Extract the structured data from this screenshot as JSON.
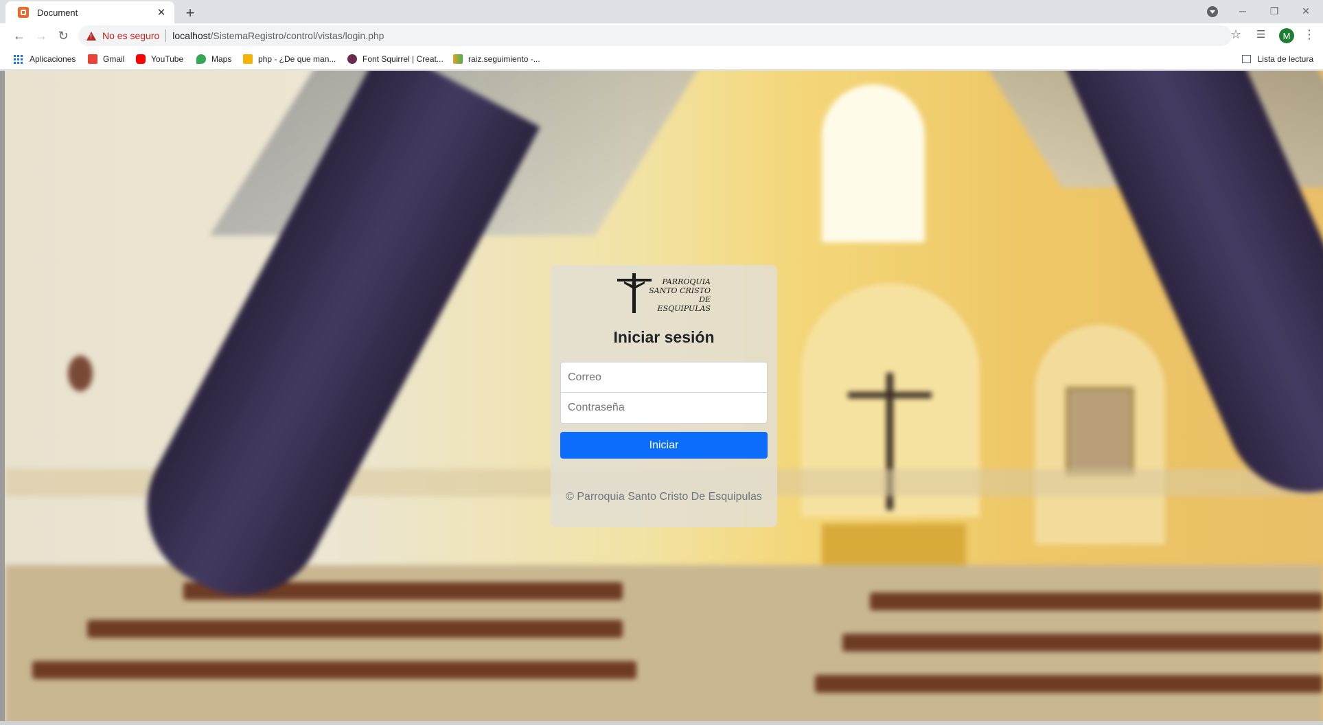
{
  "browser": {
    "tab_title": "Document",
    "security_label": "No es seguro",
    "url_host": "localhost",
    "url_path": "/SistemaRegistro/control/vistas/login.php",
    "profile_initial": "M",
    "bookmarks": [
      {
        "label": "Aplicaciones",
        "icon": "apps-icon"
      },
      {
        "label": "Gmail",
        "icon": "gmail-icon"
      },
      {
        "label": "YouTube",
        "icon": "youtube-icon"
      },
      {
        "label": "Maps",
        "icon": "maps-icon"
      },
      {
        "label": "php - ¿De que man...",
        "icon": "stackoverflow-icon"
      },
      {
        "label": "Font Squirrel | Creat...",
        "icon": "fontsquirrel-icon"
      },
      {
        "label": "raiz.seguimiento -...",
        "icon": "raiz-icon"
      }
    ],
    "reading_list_label": "Lista de lectura"
  },
  "login": {
    "logo_lines": [
      "PARROQUIA",
      "SANTO CRISTO",
      "DE ESQUIPULAS"
    ],
    "title": "Iniciar sesión",
    "email_placeholder": "Correo",
    "password_placeholder": "Contraseña",
    "submit_label": "Iniciar",
    "footer": "© Parroquia Santo Cristo De Esquipulas"
  },
  "colors": {
    "primary_button": "#0d6efd",
    "insecure_warning": "#c5221f"
  }
}
